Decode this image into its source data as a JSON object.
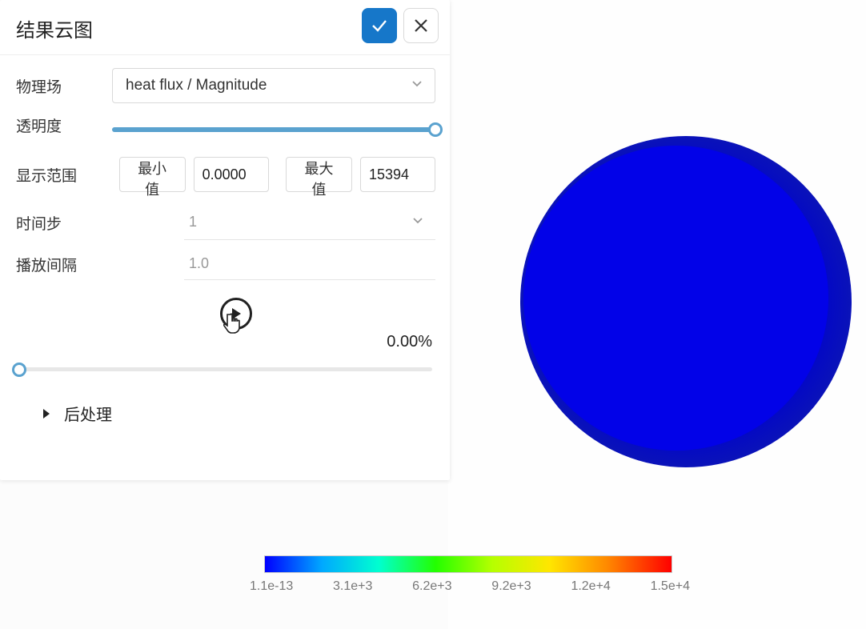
{
  "panel": {
    "title": "结果云图",
    "physics_field": {
      "label": "物理场",
      "value": "heat flux / Magnitude"
    },
    "opacity": {
      "label": "透明度"
    },
    "range": {
      "label": "显示范围",
      "min_button": "最小值",
      "min_value": "0.0000",
      "max_button": "最大值",
      "max_value": "15394"
    },
    "timestep": {
      "label": "时间步",
      "value": "1"
    },
    "interval": {
      "label": "播放间隔",
      "value": "1.0"
    },
    "progress_pct": "0.00%",
    "postprocess_section": "后处理"
  },
  "colorbar": {
    "ticks": [
      "1.1e-13",
      "3.1e+3",
      "6.2e+3",
      "9.2e+3",
      "1.2e+4",
      "1.5e+4"
    ]
  },
  "chart_data": {
    "type": "colorbar",
    "min": 1.1e-13,
    "max": 15000.0,
    "tick_values": [
      1.1e-13,
      3100.0,
      6200.0,
      9200.0,
      12000.0,
      15000.0
    ],
    "field": "heat flux / Magnitude"
  }
}
